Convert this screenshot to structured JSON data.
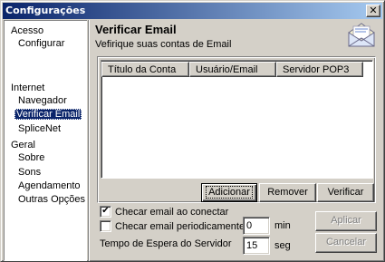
{
  "window": {
    "title": "Configurações",
    "close_glyph": "✕"
  },
  "nav": {
    "groups": [
      {
        "label": "Acesso",
        "items": [
          "Configurar"
        ]
      },
      {
        "label": "Internet",
        "items": [
          "Navegador",
          "Verificar Email",
          "SpliceNet"
        ]
      },
      {
        "label": "Geral",
        "items": [
          "Sobre",
          "Sons",
          "Agendamento",
          "Outras Opções"
        ]
      }
    ],
    "selected": "Verificar Email"
  },
  "page": {
    "title": "Verificar Email",
    "subtitle": "Vefirique suas contas de Email",
    "icon": "envelope-icon"
  },
  "accounts_table": {
    "columns": [
      "Título da Conta",
      "Usuário/Email",
      "Servidor POP3"
    ],
    "rows": []
  },
  "account_buttons": {
    "add": "Adicionar",
    "remove": "Remover",
    "check": "Verificar"
  },
  "options": {
    "check_on_connect": {
      "label": "Checar email ao conectar",
      "checked": true
    },
    "check_periodic": {
      "label": "Checar email periodicamente",
      "checked": false,
      "value": "0",
      "unit": "min"
    },
    "server_timeout": {
      "label": "Tempo de Espera do Servidor",
      "value": "15",
      "unit": "seg"
    }
  },
  "dialog_buttons": {
    "apply": "Aplicar",
    "cancel": "Cancelar"
  },
  "colors": {
    "titlebar_start": "#0a246a",
    "titlebar_end": "#a6caf0",
    "selection": "#0a246a",
    "face": "#d4d0c8"
  }
}
